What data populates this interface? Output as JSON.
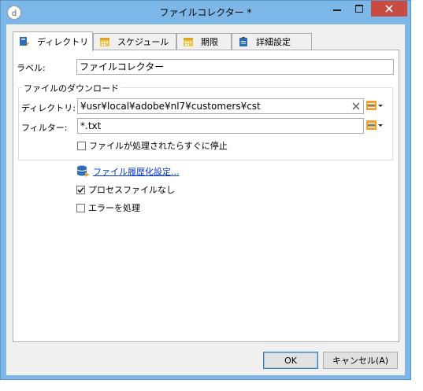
{
  "window": {
    "title": "ファイルコレクター *"
  },
  "tabs": [
    {
      "label": "ディレクトリ"
    },
    {
      "label": "スケジュール"
    },
    {
      "label": "期限"
    },
    {
      "label": "詳細設定"
    }
  ],
  "form": {
    "label_caption": "ラベル:",
    "label_value": "ファイルコレクター",
    "download_group": "ファイルのダウンロード",
    "directory_caption": "ディレクトリ:",
    "directory_value": "¥usr¥local¥adobe¥nl7¥customers¥cst",
    "filter_caption": "フィルター:",
    "filter_value": "*.txt",
    "stop_after_label": "ファイルが処理されたらすぐに停止",
    "stop_after_checked": false,
    "history_link": "ファイル履歴化設定...",
    "no_process_label": "プロセスファイルなし",
    "no_process_checked": true,
    "handle_errors_label": "エラーを処理",
    "handle_errors_checked": false
  },
  "buttons": {
    "ok": "OK",
    "cancel": "キャンセル(A)"
  },
  "colors": {
    "titlebar": "#7cb7e8",
    "close_button": "#c74b40",
    "link": "#0033cc"
  }
}
